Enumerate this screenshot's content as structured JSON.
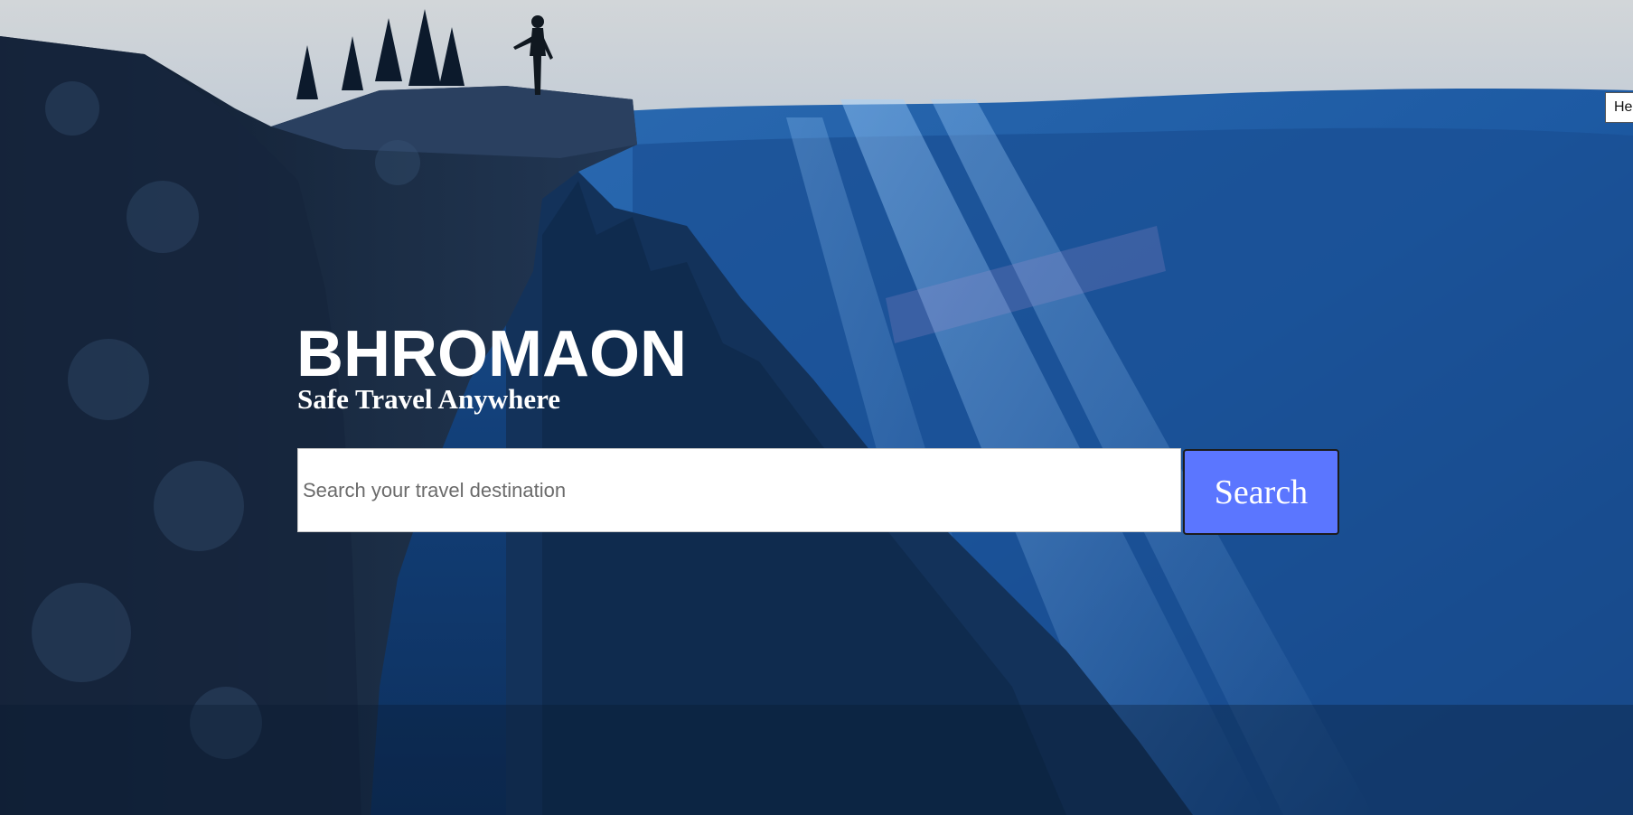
{
  "brand": {
    "title": "BHROMAON",
    "tagline": "Safe Travel Anywhere"
  },
  "search": {
    "placeholder": "Search your travel destination",
    "value": "",
    "button_label": "Search"
  },
  "edge_tab": {
    "label": "He"
  },
  "colors": {
    "search_button": "#5b76ff",
    "text": "#ffffff"
  },
  "background": {
    "icon": "mountain-cliff-photo"
  }
}
